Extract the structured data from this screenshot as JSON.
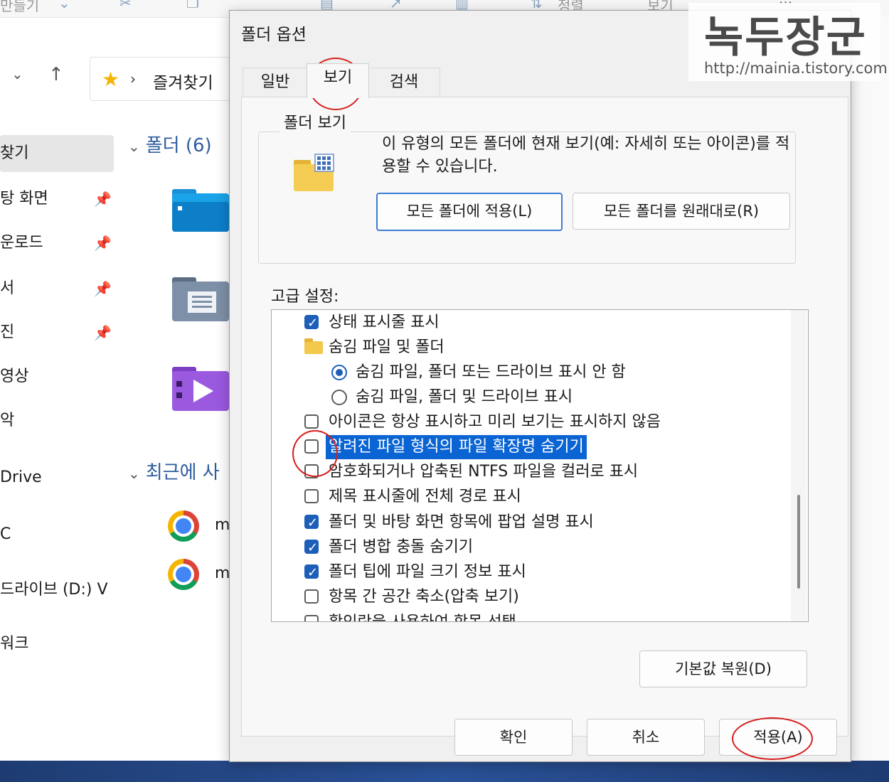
{
  "explorer": {
    "toolbar_left": "만들기",
    "toolbar_sort": "정렬",
    "toolbar_view": "보기",
    "toolbar_more": "···",
    "address": "즐겨찾기",
    "sidebar": [
      {
        "label": "찾기",
        "pinned": false
      },
      {
        "label": "탕 화면",
        "pinned": true
      },
      {
        "label": "운로드",
        "pinned": true
      },
      {
        "label": "서",
        "pinned": true
      },
      {
        "label": "진",
        "pinned": true
      },
      {
        "label": "영상",
        "pinned": false
      },
      {
        "label": "악",
        "pinned": false
      },
      {
        "label": "Drive",
        "pinned": false
      },
      {
        "label": "C",
        "pinned": false
      },
      {
        "label": "드라이브 (D:) V",
        "pinned": false
      },
      {
        "label": "워크",
        "pinned": false
      }
    ],
    "section_folders": "폴더 (6)",
    "section_recent": "최근에 사",
    "recent_items": [
      "m",
      "m"
    ]
  },
  "dialog": {
    "title": "폴더 옵션",
    "tabs": [
      "일반",
      "보기",
      "검색"
    ],
    "active_tab": "보기",
    "folder_view_group": "폴더 보기",
    "folder_view_desc": "이 유형의 모든 폴더에 현재 보기(예: 자세히 또는 아이콘)를 적용할 수 있습니다.",
    "apply_all_button": "모든 폴더에 적용(L)",
    "reset_all_button": "모든 폴더를 원래대로(R)",
    "advanced_label": "고급 설정:",
    "advanced_items": [
      {
        "type": "checkbox",
        "checked": true,
        "indent": 0,
        "label": "상태 표시줄 표시",
        "highlighted": false
      },
      {
        "type": "folder",
        "checked": false,
        "indent": 0,
        "label": "숨김 파일 및 폴더",
        "highlighted": false
      },
      {
        "type": "radio",
        "checked": true,
        "indent": 1,
        "label": "숨김 파일, 폴더 또는 드라이브 표시 안 함",
        "highlighted": false
      },
      {
        "type": "radio",
        "checked": false,
        "indent": 1,
        "label": "숨김 파일, 폴더 및 드라이브 표시",
        "highlighted": false
      },
      {
        "type": "checkbox",
        "checked": false,
        "indent": 0,
        "label": "아이콘은 항상 표시하고 미리 보기는 표시하지 않음",
        "highlighted": false
      },
      {
        "type": "checkbox",
        "checked": false,
        "indent": 0,
        "label": "알려진 파일 형식의 파일 확장명 숨기기",
        "highlighted": true
      },
      {
        "type": "checkbox",
        "checked": false,
        "indent": 0,
        "label": "암호화되거나 압축된 NTFS 파일을 컬러로 표시",
        "highlighted": false
      },
      {
        "type": "checkbox",
        "checked": false,
        "indent": 0,
        "label": "제목 표시줄에 전체 경로 표시",
        "highlighted": false
      },
      {
        "type": "checkbox",
        "checked": true,
        "indent": 0,
        "label": "폴더 및 바탕 화면 항목에 팝업 설명 표시",
        "highlighted": false
      },
      {
        "type": "checkbox",
        "checked": true,
        "indent": 0,
        "label": "폴더 병합 충돌 숨기기",
        "highlighted": false
      },
      {
        "type": "checkbox",
        "checked": true,
        "indent": 0,
        "label": "폴더 팁에 파일 크기 정보 표시",
        "highlighted": false
      },
      {
        "type": "checkbox",
        "checked": false,
        "indent": 0,
        "label": "항목 간 공간 축소(압축 보기)",
        "highlighted": false
      },
      {
        "type": "checkbox",
        "checked": false,
        "indent": 0,
        "label": "확인란을 사용하여 항목 선택",
        "highlighted": false
      }
    ],
    "restore_defaults_button": "기본값 복원(D)",
    "ok_button": "확인",
    "cancel_button": "취소",
    "apply_button": "적용(A)"
  },
  "watermark": {
    "logo": "녹두장군",
    "url": "http://mainia.tistory.com"
  }
}
